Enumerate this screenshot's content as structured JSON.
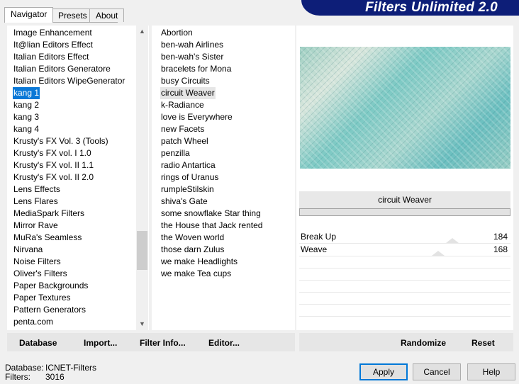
{
  "tabs": [
    "Navigator",
    "Presets",
    "About"
  ],
  "active_tab": "Navigator",
  "app_title": "Filters Unlimited 2.0",
  "categories": [
    "Image Enhancement",
    "It@lian Editors Effect",
    "Italian Editors Effect",
    "Italian Editors Generatore",
    "Italian Editors WipeGenerator",
    "kang 1",
    "kang 2",
    "kang 3",
    "kang 4",
    "Krusty's FX Vol. 3 (Tools)",
    "Krusty's FX vol. I 1.0",
    "Krusty's FX vol. II 1.1",
    "Krusty's FX vol. II 2.0",
    "Lens Effects",
    "Lens Flares",
    "MediaSpark Filters",
    "Mirror Rave",
    "MuRa's Seamless",
    "Nirvana",
    "Noise Filters",
    "Oliver's Filters",
    "Paper Backgrounds",
    "Paper Textures",
    "Pattern Generators",
    "penta.com"
  ],
  "selected_category": "kang 1",
  "filters": [
    "Abortion",
    "ben-wah Airlines",
    "ben-wah's Sister",
    "bracelets for Mona",
    "busy Circuits",
    "circuit Weaver",
    "k-Radiance",
    "love is Everywhere",
    "new Facets",
    "patch Wheel",
    "penzilla",
    "radio Antartica",
    "rings of Uranus",
    "rumpleStilskin",
    "shiva's Gate",
    "some snowflake Star thing",
    "the House that Jack rented",
    "the Woven world",
    "those darn Zulus",
    "we make Headlights",
    "we make Tea cups"
  ],
  "selected_filter": "circuit Weaver",
  "preview": {
    "filter_name": "circuit Weaver"
  },
  "params": [
    {
      "label": "Break Up",
      "value": "184"
    },
    {
      "label": "Weave",
      "value": "168"
    }
  ],
  "left_buttons": {
    "database": "Database",
    "import": "Import...",
    "filter_info": "Filter Info...",
    "editor": "Editor..."
  },
  "right_buttons": {
    "randomize": "Randomize",
    "reset": "Reset"
  },
  "status": {
    "database_label": "Database:",
    "database_value": "ICNET-Filters",
    "filters_label": "Filters:",
    "filters_value": "3016"
  },
  "dialog_buttons": {
    "apply": "Apply",
    "cancel": "Cancel",
    "help": "Help"
  }
}
